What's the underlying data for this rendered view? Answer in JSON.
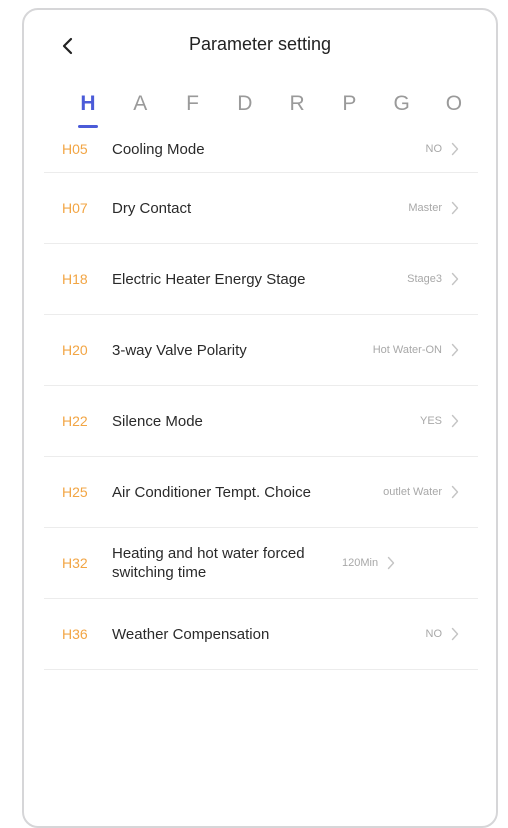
{
  "header": {
    "title": "Parameter setting"
  },
  "tabs": [
    {
      "label": "H",
      "active": true
    },
    {
      "label": "A",
      "active": false
    },
    {
      "label": "F",
      "active": false
    },
    {
      "label": "D",
      "active": false
    },
    {
      "label": "R",
      "active": false
    },
    {
      "label": "P",
      "active": false
    },
    {
      "label": "G",
      "active": false
    },
    {
      "label": "O",
      "active": false
    }
  ],
  "params": [
    {
      "code": "H05",
      "name": "Cooling Mode",
      "value": "NO"
    },
    {
      "code": "H07",
      "name": "Dry Contact",
      "value": "Master"
    },
    {
      "code": "H18",
      "name": "Electric Heater Energy Stage",
      "value": "Stage3"
    },
    {
      "code": "H20",
      "name": "3-way Valve Polarity",
      "value": "Hot Water-ON"
    },
    {
      "code": "H22",
      "name": "Silence Mode",
      "value": "YES"
    },
    {
      "code": "H25",
      "name": "Air Conditioner Tempt. Choice",
      "value": "outlet Water"
    },
    {
      "code": "H32",
      "name": "Heating and hot water forced switching time",
      "value": "120Min"
    },
    {
      "code": "H36",
      "name": "Weather Compensation",
      "value": "NO"
    }
  ],
  "colors": {
    "accent": "#4b5bd8",
    "code": "#f2a544"
  },
  "icons": {
    "back": "chevron-left-icon",
    "row_arrow": "chevron-right-icon"
  }
}
